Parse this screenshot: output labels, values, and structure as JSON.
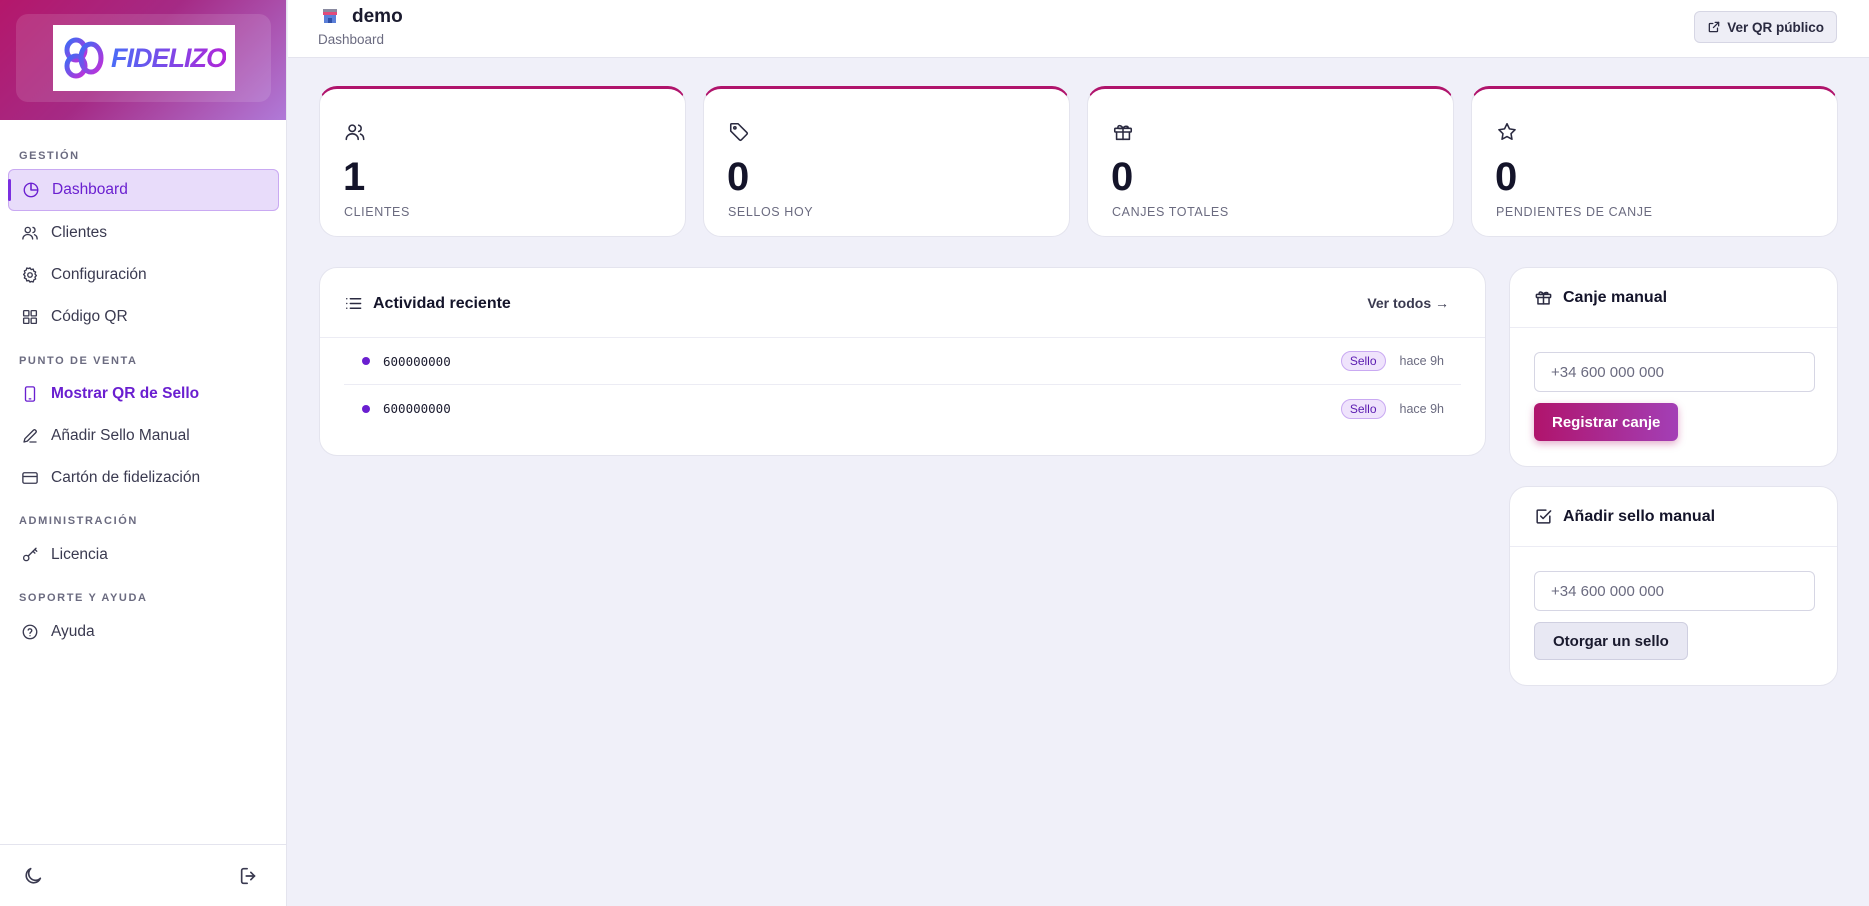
{
  "brand": {
    "logo_text": "FIDELIZO"
  },
  "sidebar": {
    "sections": [
      {
        "title": "GESTIÓN",
        "items": [
          {
            "label": "Dashboard",
            "icon": "pie-chart-icon"
          },
          {
            "label": "Clientes",
            "icon": "users-icon"
          },
          {
            "label": "Configuración",
            "icon": "gear-icon"
          },
          {
            "label": "Código QR",
            "icon": "qr-grid-icon"
          }
        ]
      },
      {
        "title": "PUNTO DE VENTA",
        "items": [
          {
            "label": "Mostrar QR de Sello",
            "icon": "phone-icon"
          },
          {
            "label": "Añadir Sello Manual",
            "icon": "pencil-icon"
          },
          {
            "label": "Cartón de fidelización",
            "icon": "card-icon"
          }
        ]
      },
      {
        "title": "ADMINISTRACIÓN",
        "items": [
          {
            "label": "Licencia",
            "icon": "key-icon"
          }
        ]
      },
      {
        "title": "SOPORTE Y AYUDA",
        "items": [
          {
            "label": "Ayuda",
            "icon": "help-circle-icon"
          }
        ]
      }
    ],
    "footer": {
      "theme_icon": "moon-icon",
      "logout_icon": "logout-icon"
    }
  },
  "header": {
    "title": "demo",
    "subtitle": "Dashboard",
    "public_qr_label": "Ver QR público",
    "store_icon": "store-icon"
  },
  "stats": [
    {
      "value": "1",
      "label": "CLIENTES",
      "icon": "users-icon"
    },
    {
      "value": "0",
      "label": "SELLOS HOY",
      "icon": "tag-icon"
    },
    {
      "value": "0",
      "label": "CANJES TOTALES",
      "icon": "gift-icon"
    },
    {
      "value": "0",
      "label": "PENDIENTES DE CANJE",
      "icon": "star-icon"
    }
  ],
  "activity": {
    "title": "Actividad reciente",
    "see_all": "Ver todos →",
    "rows": [
      {
        "phone": "600000000",
        "badge": "Sello",
        "time": "hace 9h"
      },
      {
        "phone": "600000000",
        "badge": "Sello",
        "time": "hace 9h"
      }
    ]
  },
  "redeem": {
    "title": "Canje manual",
    "placeholder": "+34 600 000 000",
    "button": "Registrar canje"
  },
  "stamp": {
    "title": "Añadir sello manual",
    "placeholder": "+34 600 000 000",
    "button": "Otorgar un sello"
  },
  "colors": {
    "accent": "#6a1fd0",
    "brand_magenta": "#b0146c",
    "background": "#f0f0f9"
  }
}
